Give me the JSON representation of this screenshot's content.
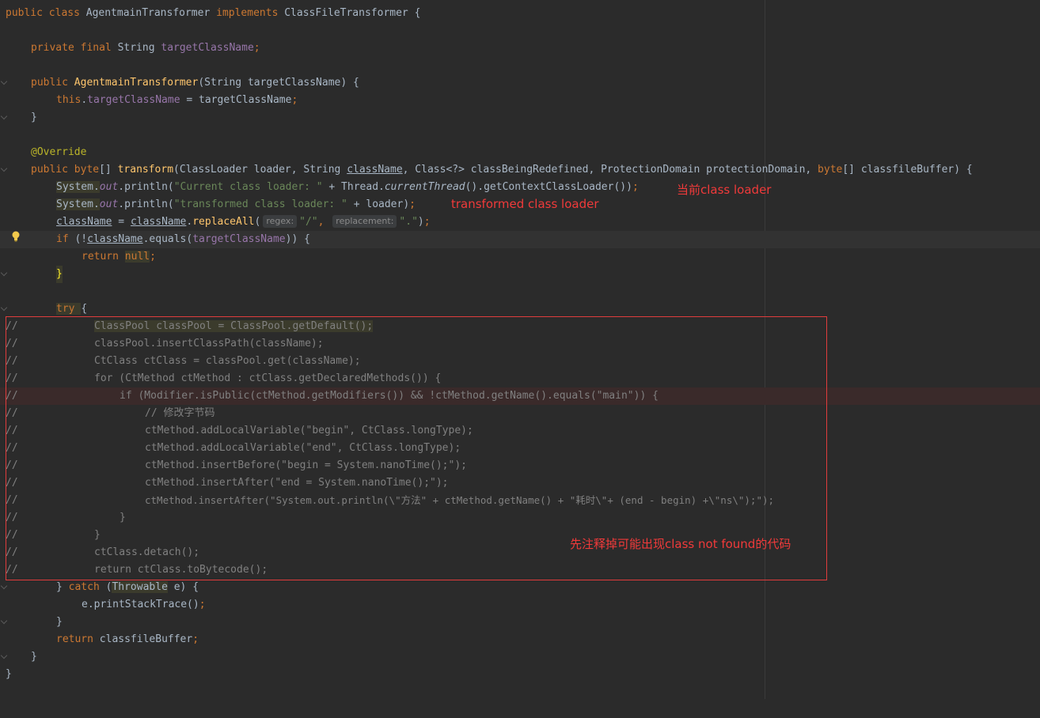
{
  "lines": {
    "l1": {
      "k1": "public class ",
      "t1": "AgentmainTransformer ",
      "k2": "implements ",
      "t2": "ClassFileTransformer {"
    },
    "l3": {
      "k1": "private final ",
      "t1": "String ",
      "f1": "targetClassName",
      "p1": ";"
    },
    "l5": {
      "k1": "public ",
      "m1": "AgentmainTransformer",
      "t1": "(String targetClassName) {"
    },
    "l6": {
      "k1": "this",
      "p1": ".",
      "f1": "targetClassName",
      "t1": " = targetClassName",
      "p2": ";"
    },
    "l7": {
      "t1": "}"
    },
    "l9": {
      "a1": "@Override"
    },
    "l10": {
      "k1": "public ",
      "k2": "byte",
      "t1": "[] ",
      "m1": "transform",
      "t2": "(ClassLoader loader, String ",
      "u1": "className",
      "t3": ", Class<?> classBeingRedefined, ProtectionDomain protectionDomain, ",
      "k3": "byte",
      "t4": "[] classfileBuffer) {"
    },
    "l11": {
      "t1": "System.",
      "f1": "out",
      "t2": ".println(",
      "s1": "\"Current class loader: \"",
      "t3": " + Thread.",
      "i1": "currentThread",
      "t4": "().getContextClassLoader())",
      "p1": ";"
    },
    "l12": {
      "t1": "System.",
      "f1": "out",
      "t2": ".println(",
      "s1": "\"transformed class loader: \"",
      "t3": " + loader)",
      "p1": ";"
    },
    "l13": {
      "u1": "className",
      "t1": " = ",
      "u2": "className",
      "t2": ".",
      "m1": "replaceAll",
      "t3": "(",
      "h1": "regex:",
      "s1": "\"/\"",
      "p1": ", ",
      "h2": "replacement:",
      "s2": "\".\"",
      "t4": ")",
      "p2": ";"
    },
    "l14": {
      "k1": "if ",
      "t1": "(!",
      "u1": "className",
      "t2": ".equals(",
      "f1": "targetClassName",
      "t3": ")) {"
    },
    "l15": {
      "k1": "return ",
      "k2": "null",
      "p1": ";"
    },
    "l16": {
      "t1": "}"
    },
    "l18": {
      "k1": "try ",
      "t1": "{"
    },
    "l19": {
      "cm": "//",
      "t1": "ClassPool classPool = ClassPool.getDefault();"
    },
    "l20": {
      "cm": "//",
      "t1": "classPool.insertClassPath(className);"
    },
    "l21": {
      "cm": "//",
      "t1": "CtClass ctClass = classPool.get(className);"
    },
    "l22": {
      "cm": "//",
      "t1": "for (CtMethod ctMethod : ctClass.getDeclaredMethods()) {"
    },
    "l23": {
      "cm": "//",
      "t1": "if (Modifier.isPublic(ctMethod.getModifiers()) && !ctMethod.getName().equals(\"main\")) {"
    },
    "l24": {
      "cm": "//",
      "t1": "// 修改字节码"
    },
    "l25": {
      "cm": "//",
      "t1": "ctMethod.addLocalVariable(\"begin\", CtClass.longType);"
    },
    "l26": {
      "cm": "//",
      "t1": "ctMethod.addLocalVariable(\"end\", CtClass.longType);"
    },
    "l27": {
      "cm": "//",
      "t1": "ctMethod.insertBefore(\"begin = System.nanoTime();\");"
    },
    "l28": {
      "cm": "//",
      "t1": "ctMethod.insertAfter(\"end = System.nanoTime();\");"
    },
    "l29": {
      "cm": "//",
      "t1": "ctMethod.insertAfter(\"System.out.println(\\\"方法\" + ctMethod.getName() + \"耗时\\\"+ (end - begin) +\\\"ns\\\");\");"
    },
    "l30": {
      "cm": "//",
      "t1": "}"
    },
    "l31": {
      "cm": "//",
      "t1": "}"
    },
    "l32": {
      "cm": "//",
      "t1": "ctClass.detach();"
    },
    "l33": {
      "cm": "//",
      "t1": "return ctClass.toBytecode();"
    },
    "l34": {
      "t1": "} ",
      "k1": "catch ",
      "t2": "(",
      "t3": "Throwable",
      "t4": " e) {"
    },
    "l35": {
      "t1": "e.printStackTrace()",
      "p1": ";"
    },
    "l36": {
      "t1": "}"
    },
    "l37": {
      "k1": "return ",
      "t1": "classfileBuffer",
      "p1": ";"
    },
    "l38": {
      "t1": "}"
    },
    "l39": {
      "t1": "}"
    }
  },
  "annotations": {
    "current_loader": "当前class loader",
    "transformed_loader": "transformed class loader",
    "commented_out": "先注释掉可能出现class not found的代码"
  },
  "colors": {
    "keyword": "#cc7832",
    "field": "#9876aa",
    "string": "#6a8759",
    "method": "#ffc66d",
    "annotation": "#bbb529",
    "comment": "#808080",
    "text": "#a9b7c6",
    "note": "#f03a3a"
  },
  "icons": {
    "gutter_bulb": "lightbulb-icon",
    "fold": "fold-marker-icon"
  }
}
